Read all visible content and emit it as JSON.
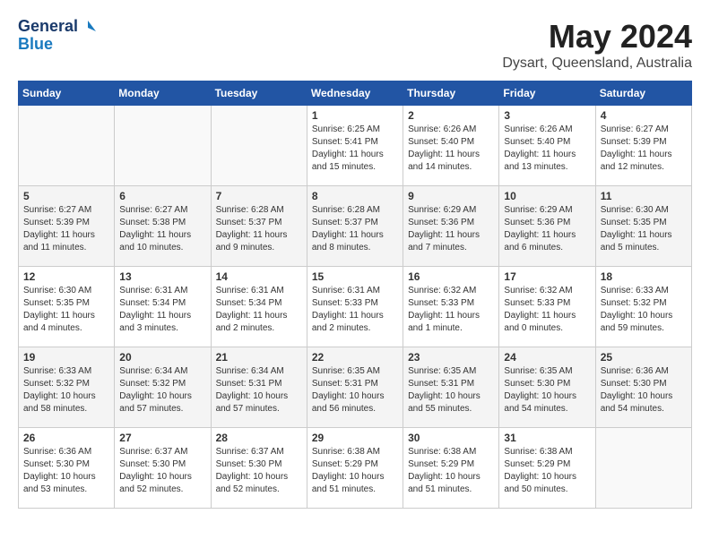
{
  "header": {
    "logo_line1": "General",
    "logo_line2": "Blue",
    "month": "May 2024",
    "location": "Dysart, Queensland, Australia"
  },
  "weekdays": [
    "Sunday",
    "Monday",
    "Tuesday",
    "Wednesday",
    "Thursday",
    "Friday",
    "Saturday"
  ],
  "rows": [
    [
      {
        "day": "",
        "info": ""
      },
      {
        "day": "",
        "info": ""
      },
      {
        "day": "",
        "info": ""
      },
      {
        "day": "1",
        "info": "Sunrise: 6:25 AM\nSunset: 5:41 PM\nDaylight: 11 hours\nand 15 minutes."
      },
      {
        "day": "2",
        "info": "Sunrise: 6:26 AM\nSunset: 5:40 PM\nDaylight: 11 hours\nand 14 minutes."
      },
      {
        "day": "3",
        "info": "Sunrise: 6:26 AM\nSunset: 5:40 PM\nDaylight: 11 hours\nand 13 minutes."
      },
      {
        "day": "4",
        "info": "Sunrise: 6:27 AM\nSunset: 5:39 PM\nDaylight: 11 hours\nand 12 minutes."
      }
    ],
    [
      {
        "day": "5",
        "info": "Sunrise: 6:27 AM\nSunset: 5:39 PM\nDaylight: 11 hours\nand 11 minutes."
      },
      {
        "day": "6",
        "info": "Sunrise: 6:27 AM\nSunset: 5:38 PM\nDaylight: 11 hours\nand 10 minutes."
      },
      {
        "day": "7",
        "info": "Sunrise: 6:28 AM\nSunset: 5:37 PM\nDaylight: 11 hours\nand 9 minutes."
      },
      {
        "day": "8",
        "info": "Sunrise: 6:28 AM\nSunset: 5:37 PM\nDaylight: 11 hours\nand 8 minutes."
      },
      {
        "day": "9",
        "info": "Sunrise: 6:29 AM\nSunset: 5:36 PM\nDaylight: 11 hours\nand 7 minutes."
      },
      {
        "day": "10",
        "info": "Sunrise: 6:29 AM\nSunset: 5:36 PM\nDaylight: 11 hours\nand 6 minutes."
      },
      {
        "day": "11",
        "info": "Sunrise: 6:30 AM\nSunset: 5:35 PM\nDaylight: 11 hours\nand 5 minutes."
      }
    ],
    [
      {
        "day": "12",
        "info": "Sunrise: 6:30 AM\nSunset: 5:35 PM\nDaylight: 11 hours\nand 4 minutes."
      },
      {
        "day": "13",
        "info": "Sunrise: 6:31 AM\nSunset: 5:34 PM\nDaylight: 11 hours\nand 3 minutes."
      },
      {
        "day": "14",
        "info": "Sunrise: 6:31 AM\nSunset: 5:34 PM\nDaylight: 11 hours\nand 2 minutes."
      },
      {
        "day": "15",
        "info": "Sunrise: 6:31 AM\nSunset: 5:33 PM\nDaylight: 11 hours\nand 2 minutes."
      },
      {
        "day": "16",
        "info": "Sunrise: 6:32 AM\nSunset: 5:33 PM\nDaylight: 11 hours\nand 1 minute."
      },
      {
        "day": "17",
        "info": "Sunrise: 6:32 AM\nSunset: 5:33 PM\nDaylight: 11 hours\nand 0 minutes."
      },
      {
        "day": "18",
        "info": "Sunrise: 6:33 AM\nSunset: 5:32 PM\nDaylight: 10 hours\nand 59 minutes."
      }
    ],
    [
      {
        "day": "19",
        "info": "Sunrise: 6:33 AM\nSunset: 5:32 PM\nDaylight: 10 hours\nand 58 minutes."
      },
      {
        "day": "20",
        "info": "Sunrise: 6:34 AM\nSunset: 5:32 PM\nDaylight: 10 hours\nand 57 minutes."
      },
      {
        "day": "21",
        "info": "Sunrise: 6:34 AM\nSunset: 5:31 PM\nDaylight: 10 hours\nand 57 minutes."
      },
      {
        "day": "22",
        "info": "Sunrise: 6:35 AM\nSunset: 5:31 PM\nDaylight: 10 hours\nand 56 minutes."
      },
      {
        "day": "23",
        "info": "Sunrise: 6:35 AM\nSunset: 5:31 PM\nDaylight: 10 hours\nand 55 minutes."
      },
      {
        "day": "24",
        "info": "Sunrise: 6:35 AM\nSunset: 5:30 PM\nDaylight: 10 hours\nand 54 minutes."
      },
      {
        "day": "25",
        "info": "Sunrise: 6:36 AM\nSunset: 5:30 PM\nDaylight: 10 hours\nand 54 minutes."
      }
    ],
    [
      {
        "day": "26",
        "info": "Sunrise: 6:36 AM\nSunset: 5:30 PM\nDaylight: 10 hours\nand 53 minutes."
      },
      {
        "day": "27",
        "info": "Sunrise: 6:37 AM\nSunset: 5:30 PM\nDaylight: 10 hours\nand 52 minutes."
      },
      {
        "day": "28",
        "info": "Sunrise: 6:37 AM\nSunset: 5:30 PM\nDaylight: 10 hours\nand 52 minutes."
      },
      {
        "day": "29",
        "info": "Sunrise: 6:38 AM\nSunset: 5:29 PM\nDaylight: 10 hours\nand 51 minutes."
      },
      {
        "day": "30",
        "info": "Sunrise: 6:38 AM\nSunset: 5:29 PM\nDaylight: 10 hours\nand 51 minutes."
      },
      {
        "day": "31",
        "info": "Sunrise: 6:38 AM\nSunset: 5:29 PM\nDaylight: 10 hours\nand 50 minutes."
      },
      {
        "day": "",
        "info": ""
      }
    ]
  ]
}
